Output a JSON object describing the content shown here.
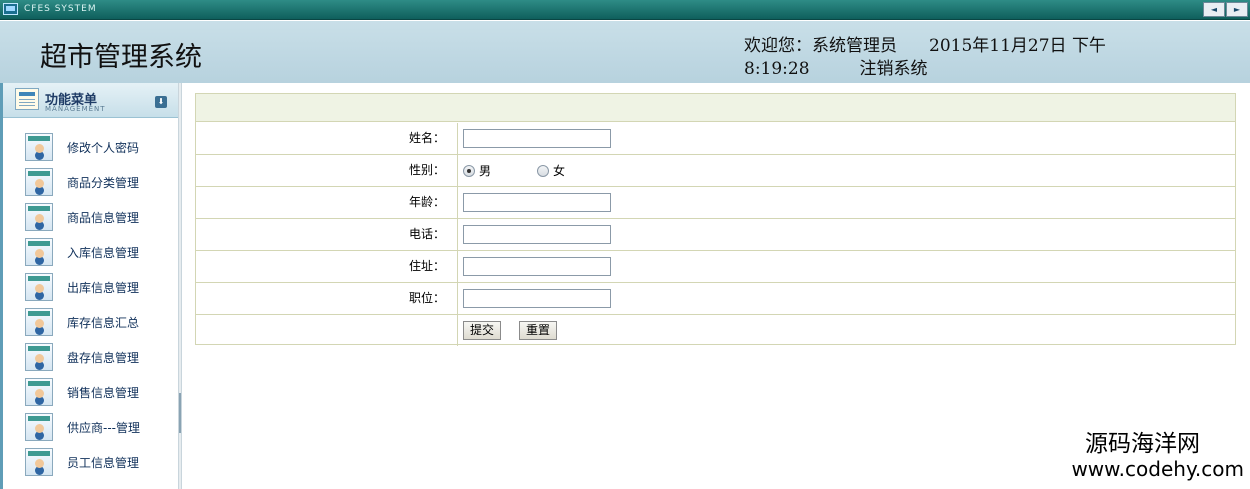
{
  "system": {
    "title": "CFES SYSTEM",
    "nav_prev": "◄",
    "nav_next": "►"
  },
  "header": {
    "app_title": "超市管理系统",
    "welcome_label": "欢迎您：",
    "user_name": "系统管理员",
    "date": "2015年11月27日",
    "ampm": "下午",
    "time": "8:19:28",
    "logout": "注销系统"
  },
  "sidebar": {
    "head_title": "功能菜单",
    "head_sub": "MANAGEMENT",
    "collapse_glyph": "⬇",
    "items": [
      {
        "label": "修改个人密码"
      },
      {
        "label": "商品分类管理"
      },
      {
        "label": "商品信息管理"
      },
      {
        "label": "入库信息管理"
      },
      {
        "label": "出库信息管理"
      },
      {
        "label": "库存信息汇总"
      },
      {
        "label": "盘存信息管理"
      },
      {
        "label": "销售信息管理"
      },
      {
        "label": "供应商---管理"
      },
      {
        "label": "员工信息管理"
      }
    ]
  },
  "form": {
    "name_label": "姓名：",
    "name_value": "",
    "gender_label": "性别：",
    "gender_male": "男",
    "gender_female": "女",
    "gender_selected": "男",
    "age_label": "年龄：",
    "age_value": "",
    "phone_label": "电话：",
    "phone_value": "",
    "address_label": "住址：",
    "address_value": "",
    "position_label": "职位：",
    "position_value": "",
    "submit": "提交",
    "reset": "重置"
  },
  "watermark": {
    "cn": "源码海洋网",
    "url": "www.codehy.com"
  }
}
